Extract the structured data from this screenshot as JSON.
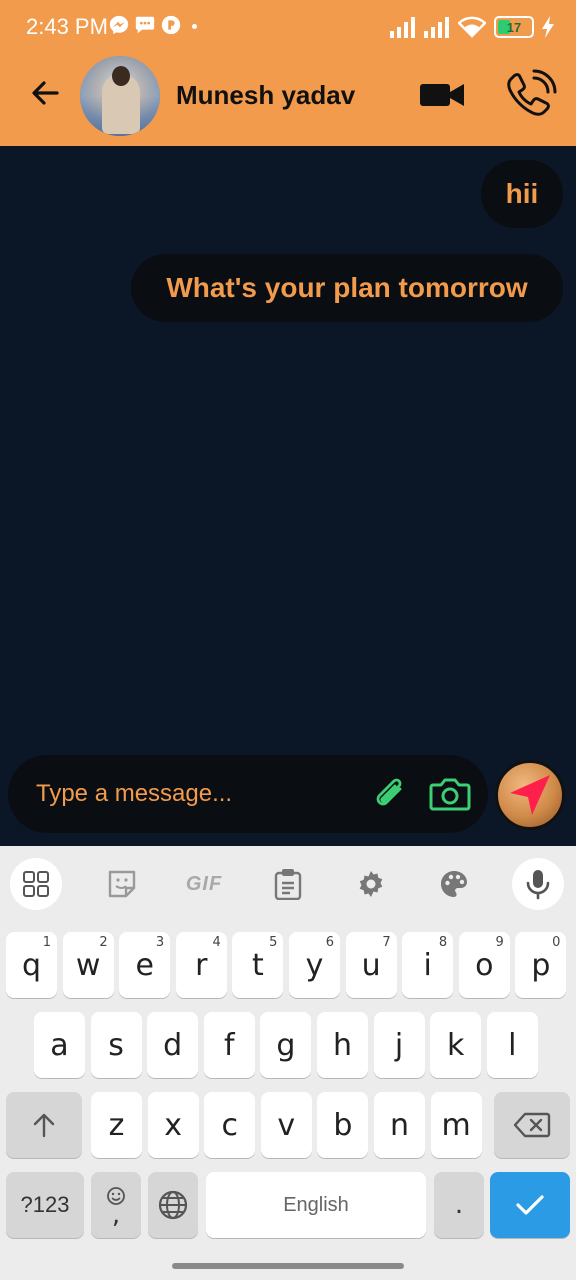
{
  "status_bar": {
    "time": "2:43 PM",
    "battery": "17"
  },
  "header": {
    "contact_name": "Munesh yadav"
  },
  "messages": [
    {
      "text": "hii"
    },
    {
      "text": "What's your plan tomorrow"
    }
  ],
  "compose": {
    "placeholder": "Type a message..."
  },
  "keyboard": {
    "toolbar": {
      "gif": "GIF"
    },
    "row1": [
      {
        "k": "q",
        "n": "1"
      },
      {
        "k": "w",
        "n": "2"
      },
      {
        "k": "e",
        "n": "3"
      },
      {
        "k": "r",
        "n": "4"
      },
      {
        "k": "t",
        "n": "5"
      },
      {
        "k": "y",
        "n": "6"
      },
      {
        "k": "u",
        "n": "7"
      },
      {
        "k": "i",
        "n": "8"
      },
      {
        "k": "o",
        "n": "9"
      },
      {
        "k": "p",
        "n": "0"
      }
    ],
    "row2": [
      "a",
      "s",
      "d",
      "f",
      "g",
      "h",
      "j",
      "k",
      "l"
    ],
    "row3": [
      "z",
      "x",
      "c",
      "v",
      "b",
      "n",
      "m"
    ],
    "symbols_label": "?123",
    "comma": ",",
    "space_label": "English",
    "period": "."
  },
  "colors": {
    "accent": "#f29b4c",
    "chat_bg": "#0b1727",
    "bubble_bg": "#0a0d12",
    "icon_green": "#3ccf73",
    "send_arrow": "#ff1f4b",
    "enter_key": "#2c9be6"
  }
}
